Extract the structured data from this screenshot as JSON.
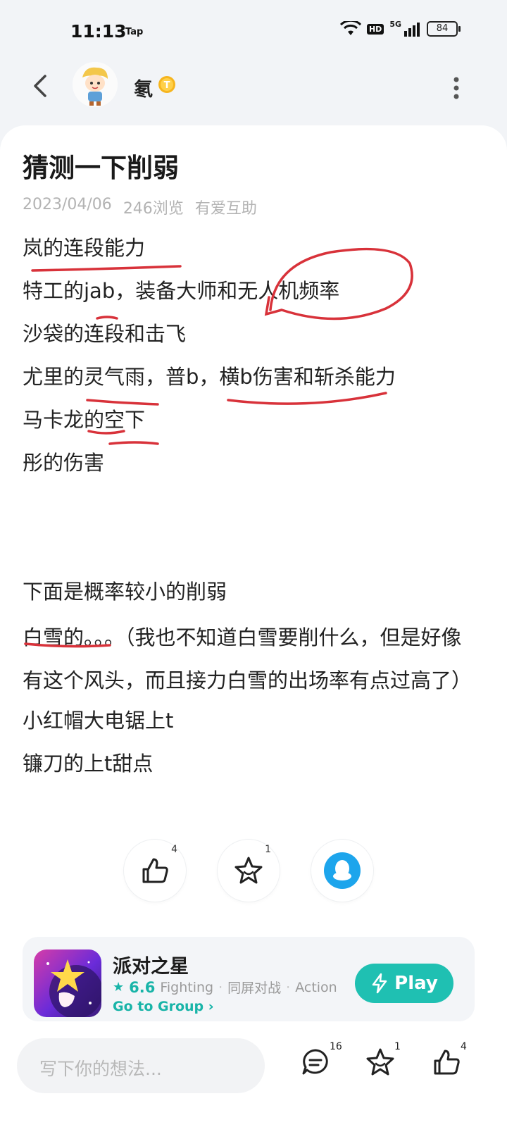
{
  "status_bar": {
    "time": "11:13",
    "carrier_app": "Tap",
    "network": "5G",
    "hd": "HD",
    "battery": "84"
  },
  "header": {
    "username": "氡",
    "level_badge": "T"
  },
  "post": {
    "title": "猜测一下削弱",
    "date": "2023/04/06",
    "views": "246浏览",
    "category": "有爱互助",
    "lines": [
      "岚的连段能力",
      "特工的jab，装备大师和无人机频率",
      "沙袋的连段和击飞",
      "尤里的灵气雨，普b，横b伤害和斩杀能力",
      "马卡龙的空下",
      "彤的伤害",
      "下面是概率较小的削弱",
      "白雪的。。。（我也不知道白雪要削什么，但是好像有这个风头，而且接力白雪的出场率有点过高了）",
      "小红帽大电锯上t",
      "镰刀的上t甜点"
    ]
  },
  "actions": {
    "like_count": "4",
    "favorite_count": "1"
  },
  "game": {
    "name": "派对之星",
    "rating": "6.6",
    "tags": [
      "Fighting",
      "同屏对战",
      "Action"
    ],
    "group_link": "Go to Group",
    "play_label": "Play"
  },
  "bottom_bar": {
    "comment_placeholder": "写下你的想法...",
    "comment_count": "16",
    "favorite_count": "1",
    "like_count": "4"
  }
}
